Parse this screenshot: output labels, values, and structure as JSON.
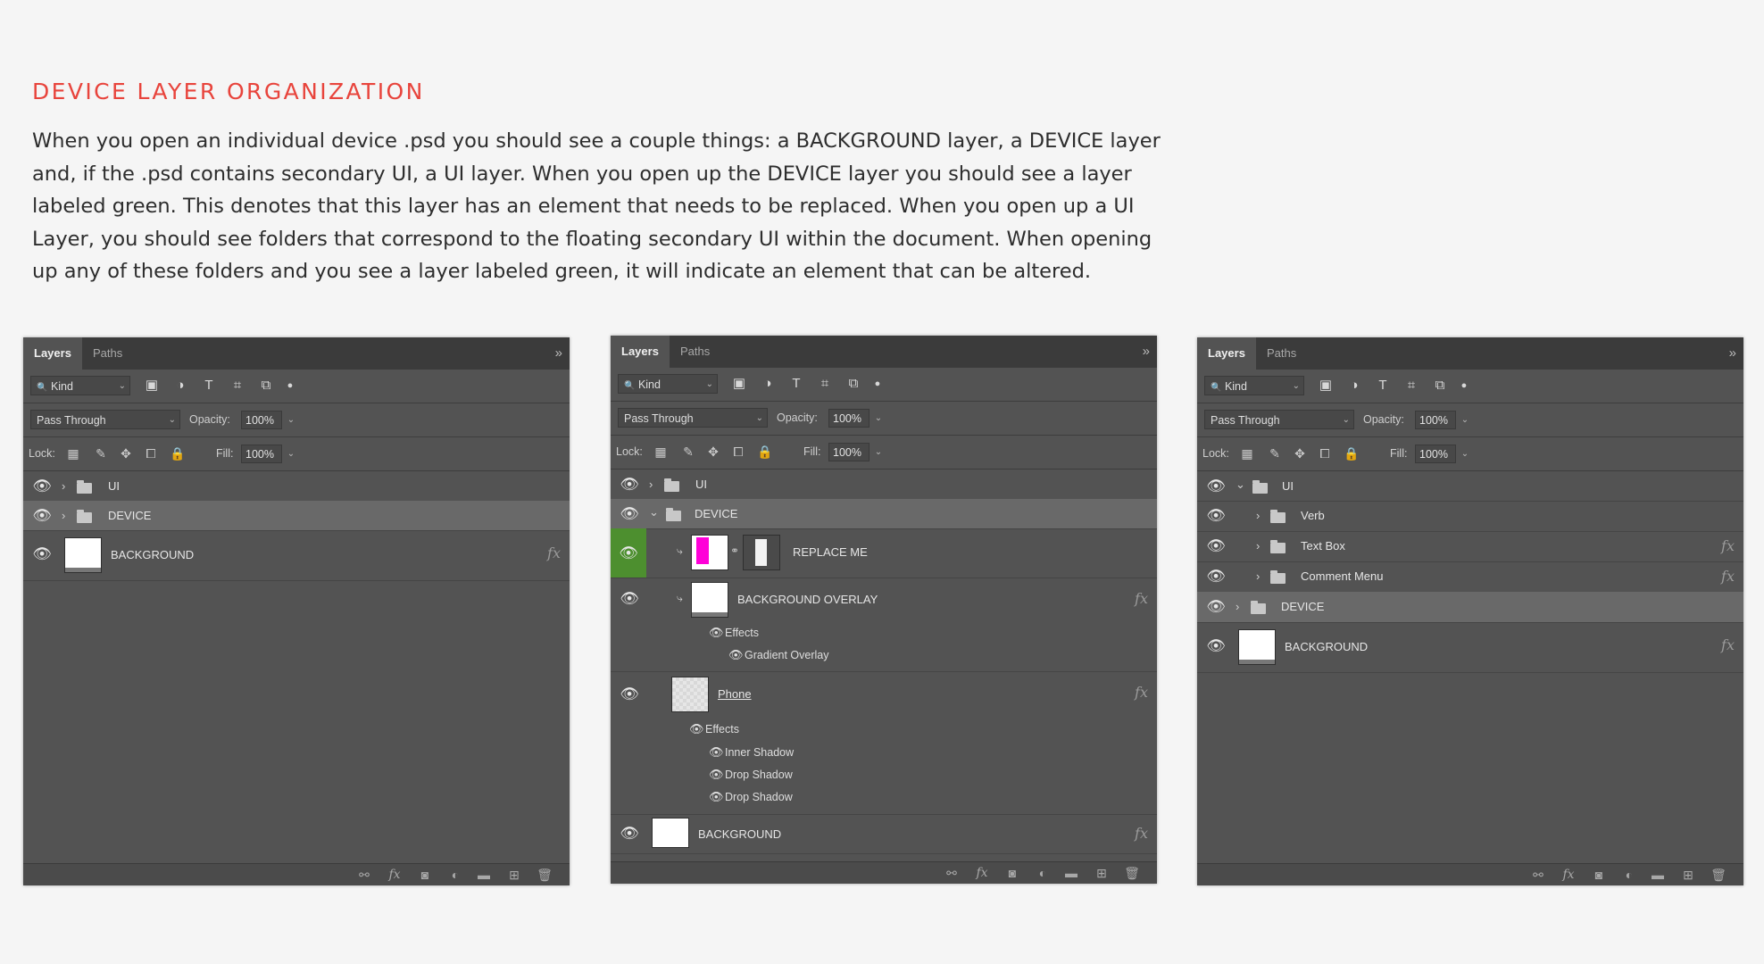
{
  "heading": "DEVICE LAYER ORGANIZATION",
  "intro_lines": [
    "When you open an individual device .psd you should see a couple things:  a BACKGROUND layer, a DEVICE layer",
    "and, if the .psd contains secondary UI, a UI layer. When you open up the DEVICE layer you should see a layer",
    "labeled green. This denotes that this layer has an element that needs to be replaced. When you open up a UI",
    "Layer, you should see folders that correspond to the floating secondary UI within the document. When opening",
    "up any of these folders and you see a layer labeled green, it will indicate an element that can be altered."
  ],
  "panel_ui": {
    "tab_layers": "Layers",
    "tab_paths": "Paths",
    "collapse_glyph": "»",
    "kind_label": "Kind",
    "blend_mode": "Pass Through",
    "opacity_label": "Opacity:",
    "opacity_value": "100%",
    "lock_label": "Lock:",
    "fill_label": "Fill:",
    "fill_value": "100%",
    "fx_glyph": "fx",
    "icons": {
      "eye": "👁",
      "chevron_right": "›",
      "chevron_down": "⌄",
      "dropdown": "⌄",
      "search": "🔍",
      "image_filter": "▣",
      "adjustment_filter": "◑",
      "type_filter": "T",
      "shape_filter": "⌗",
      "smart_object_filter": "⧉",
      "filter_toggle": "●",
      "lock_transparent": "▦",
      "lock_paint": "✎",
      "lock_move": "✥",
      "lock_artboard": "⧠",
      "lock_all": "🔒",
      "clip": "⤷",
      "chain": "⚭",
      "link": "⚯",
      "mask": "◙",
      "new_fill": "◐",
      "new_group": "▬",
      "new_layer": "⊞",
      "trash": "🗑"
    }
  },
  "panel1": {
    "layers": [
      {
        "name": "UI"
      },
      {
        "name": "DEVICE"
      },
      {
        "name": "BACKGROUND"
      }
    ]
  },
  "panel2": {
    "layers": [
      {
        "name": "UI"
      },
      {
        "name": "DEVICE"
      },
      {
        "name": "REPLACE ME"
      },
      {
        "name": "BACKGROUND OVERLAY"
      },
      {
        "name": "Phone"
      },
      {
        "name": "BACKGROUND"
      }
    ],
    "effects_label": "Effects",
    "overlay_effects": [
      "Gradient Overlay"
    ],
    "phone_effects": [
      "Inner Shadow",
      "Drop Shadow",
      "Drop Shadow"
    ]
  },
  "panel3": {
    "layers": [
      {
        "name": "UI"
      },
      {
        "name": "Verb"
      },
      {
        "name": "Text Box"
      },
      {
        "name": "Comment Menu"
      },
      {
        "name": "DEVICE"
      },
      {
        "name": "BACKGROUND"
      }
    ]
  }
}
